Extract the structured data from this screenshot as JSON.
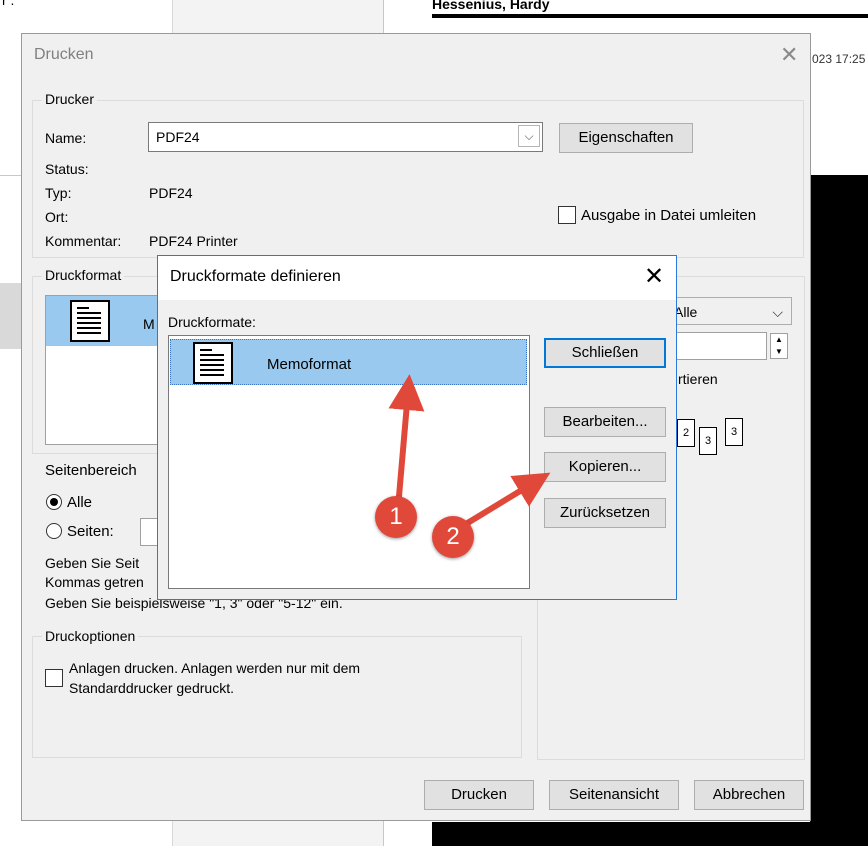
{
  "background": {
    "header_name": "Hessenius, Hardy",
    "date_fragment": "023 17:25",
    "corner_text": "r ."
  },
  "print_dialog": {
    "title": "Drucken",
    "printer_group": {
      "label": "Drucker",
      "name_label": "Name:",
      "name_value": "PDF24",
      "properties_button": "Eigenschaften",
      "status_label": "Status:",
      "type_label": "Typ:",
      "type_value": "PDF24",
      "location_label": "Ort:",
      "comment_label": "Kommentar:",
      "comment_value": "PDF24 Printer",
      "print_to_file_label": "Ausgabe in Datei umleiten"
    },
    "format_group": {
      "label": "Druckformat",
      "item_label_fragment": "M"
    },
    "copies_group": {
      "select_value": "Alle",
      "collate_fragment": "rtieren",
      "page_icons": [
        "2",
        "3",
        "3"
      ]
    },
    "page_range": {
      "label": "Seitenbereich",
      "all_label": "Alle",
      "pages_label": "Seiten:",
      "help_line1": "Geben Sie Seit",
      "help_line2": "Kommas getren",
      "help_line3": "Geben Sie beispielsweise \"1, 3\" oder \"5-12\" ein."
    },
    "print_options": {
      "label": "Druckoptionen",
      "attachments_label_line1": "Anlagen drucken. Anlagen werden nur mit dem",
      "attachments_label_line2": "Standarddrucker gedruckt."
    },
    "footer": {
      "print_button": "Drucken",
      "preview_button": "Seitenansicht",
      "cancel_button": "Abbrechen"
    }
  },
  "formats_dialog": {
    "title": "Druckformate definieren",
    "list_label": "Druckformate:",
    "items": [
      {
        "label": "Memoformat",
        "selected": true,
        "icon": "memo-document-icon"
      }
    ],
    "buttons": {
      "close": "Schließen",
      "edit": "Bearbeiten...",
      "copy": "Kopieren...",
      "reset": "Zurücksetzen"
    }
  },
  "annotations": {
    "arrow_color": "#e0483a",
    "badge1": "1",
    "badge2": "2"
  },
  "colors": {
    "selection": "#99c9ef",
    "accent_border": "#2b79d8",
    "dialog_bg": "#f0f0f0"
  }
}
